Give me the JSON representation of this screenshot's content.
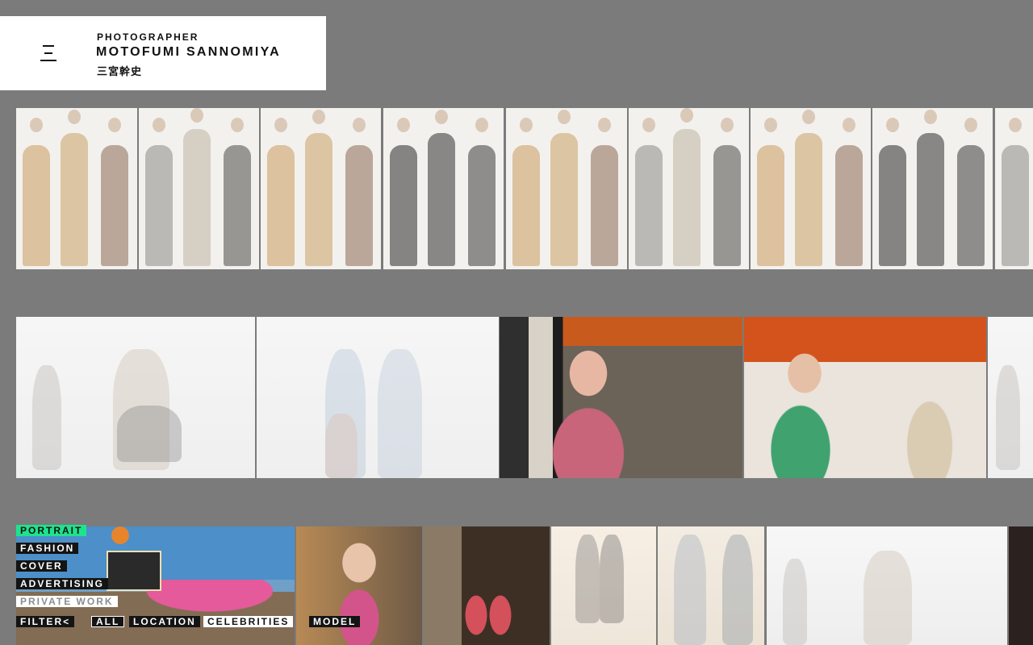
{
  "brand": {
    "role": "PHOTOGRAPHER",
    "name": "MOTOFUMI SANNOMIYA",
    "name_jp": "三宮幹史"
  },
  "menu": {
    "items": [
      "PORTRAIT",
      "FASHION",
      "COVER",
      "ADVERTISING",
      "PRIVATE WORK"
    ],
    "active": "PORTRAIT",
    "filter_label": "FILTER<",
    "filters": [
      "ALL",
      "LOCATION",
      "CELEBRITIES",
      "MODEL"
    ]
  },
  "colors": {
    "background": "#7b7b7b",
    "accent": "#1de48c"
  }
}
